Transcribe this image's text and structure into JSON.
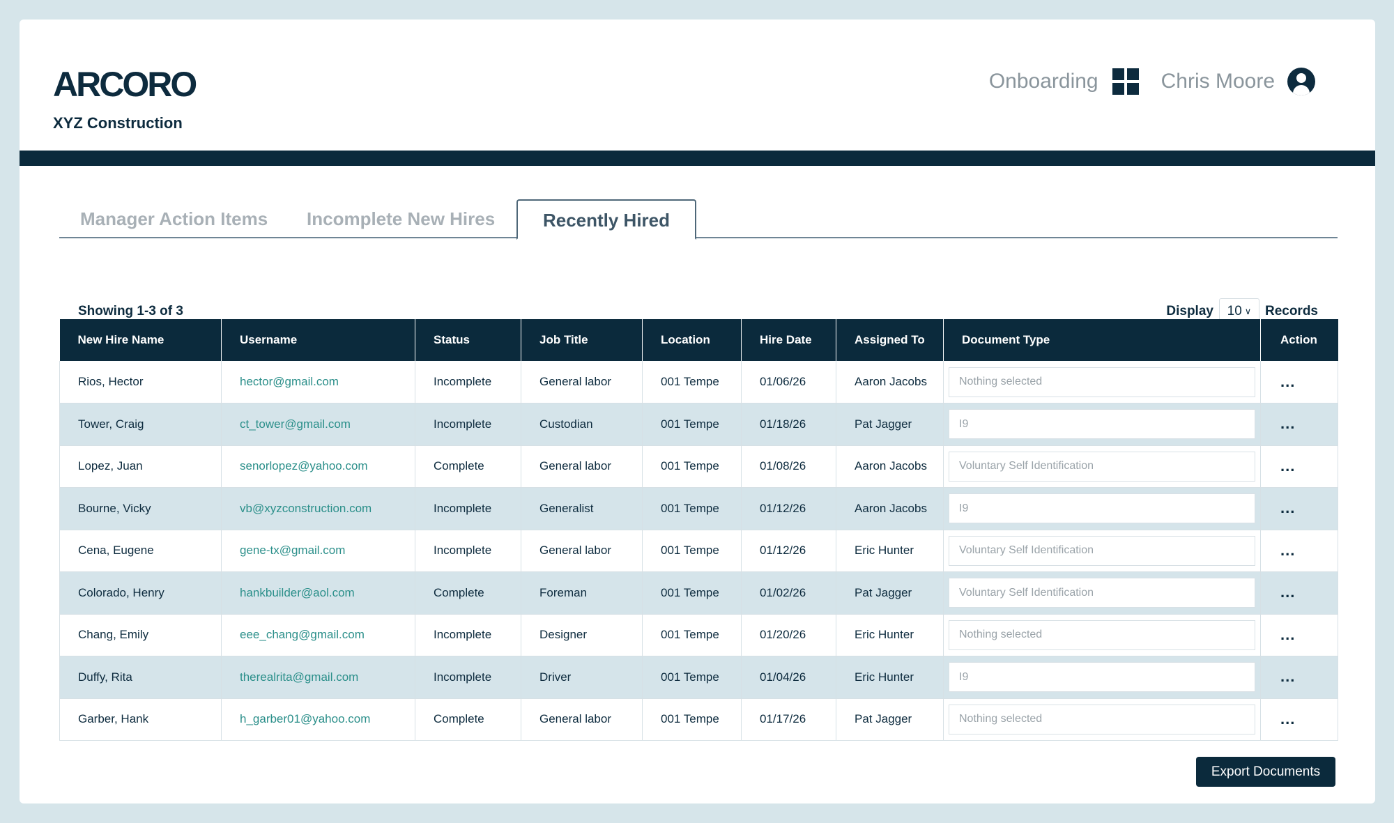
{
  "brand": {
    "logo_text": "ARCORO",
    "company": "XYZ Construction"
  },
  "header": {
    "nav_label": "Onboarding",
    "user_name": "Chris Moore",
    "icons": [
      "grid-icon",
      "user-icon"
    ]
  },
  "tabs": [
    {
      "label": "Manager Action Items",
      "active": false
    },
    {
      "label": "Incomplete New Hires",
      "active": false
    },
    {
      "label": "Recently Hired",
      "active": true
    }
  ],
  "pagination": {
    "showing": "Showing 1-3 of 3"
  },
  "display": {
    "label": "Display",
    "value": "10",
    "suffix": "Records"
  },
  "table": {
    "columns": [
      "New Hire Name",
      "Username",
      "Status",
      "Job Title",
      "Location",
      "Hire Date",
      "Assigned To",
      "Document Type",
      "Action"
    ],
    "rows": [
      {
        "name": "Rios, Hector",
        "username": "hector@gmail.com",
        "status": "Incomplete",
        "job": "General labor",
        "location": "001 Tempe",
        "date": "01/06/26",
        "assigned": "Aaron Jacobs",
        "doc": "Nothing selected",
        "action": "..."
      },
      {
        "name": "Tower, Craig",
        "username": "ct_tower@gmail.com",
        "status": "Incomplete",
        "job": "Custodian",
        "location": "001 Tempe",
        "date": "01/18/26",
        "assigned": "Pat Jagger",
        "doc": "I9",
        "action": "..."
      },
      {
        "name": "Lopez, Juan",
        "username": "senorlopez@yahoo.com",
        "status": "Complete",
        "job": "General labor",
        "location": "001 Tempe",
        "date": "01/08/26",
        "assigned": "Aaron Jacobs",
        "doc": "Voluntary Self Identification",
        "action": "..."
      },
      {
        "name": "Bourne, Vicky",
        "username": "vb@xyzconstruction.com",
        "status": "Incomplete",
        "job": "Generalist",
        "location": "001 Tempe",
        "date": "01/12/26",
        "assigned": "Aaron Jacobs",
        "doc": "I9",
        "action": "..."
      },
      {
        "name": "Cena, Eugene",
        "username": "gene-tx@gmail.com",
        "status": "Incomplete",
        "job": "General labor",
        "location": "001 Tempe",
        "date": "01/12/26",
        "assigned": "Eric Hunter",
        "doc": "Voluntary Self Identification",
        "action": "..."
      },
      {
        "name": "Colorado, Henry",
        "username": "hankbuilder@aol.com",
        "status": "Complete",
        "job": "Foreman",
        "location": "001 Tempe",
        "date": "01/02/26",
        "assigned": "Pat Jagger",
        "doc": "Voluntary Self Identification",
        "action": "..."
      },
      {
        "name": "Chang, Emily",
        "username": "eee_chang@gmail.com",
        "status": "Incomplete",
        "job": "Designer",
        "location": "001 Tempe",
        "date": "01/20/26",
        "assigned": "Eric Hunter",
        "doc": "Nothing selected",
        "action": "..."
      },
      {
        "name": "Duffy, Rita",
        "username": "therealrita@gmail.com",
        "status": "Incomplete",
        "job": "Driver",
        "location": "001 Tempe",
        "date": "01/04/26",
        "assigned": "Eric Hunter",
        "doc": "I9",
        "action": "..."
      },
      {
        "name": "Garber, Hank",
        "username": "h_garber01@yahoo.com",
        "status": "Complete",
        "job": "General labor",
        "location": "001 Tempe",
        "date": "01/17/26",
        "assigned": "Pat Jagger",
        "doc": "Nothing selected",
        "action": "..."
      }
    ]
  },
  "export_button": "Export Documents",
  "colors": {
    "navy": "#0b2a3c",
    "link_teal": "#2b8f8a",
    "row_alt": "#d5e4ea",
    "page_bg": "#d6e5ea"
  }
}
